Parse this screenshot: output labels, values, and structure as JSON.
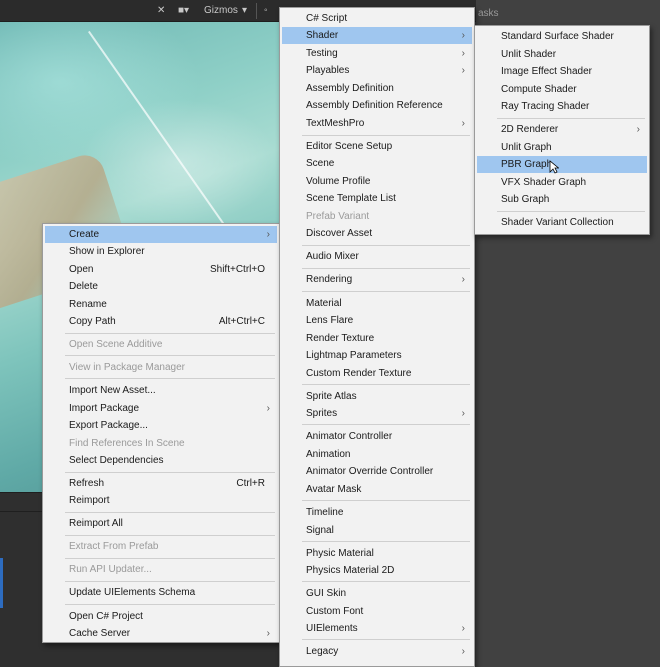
{
  "toolbar": {
    "gizmos_label": "Gizmos",
    "tasks_label": "asks"
  },
  "context_menu": {
    "items": [
      {
        "label": "Create",
        "arrow": "›"
      },
      {
        "label": "Show in Explorer"
      },
      {
        "label": "Open",
        "shortcut": "Shift+Ctrl+O"
      },
      {
        "label": "Delete"
      },
      {
        "label": "Rename"
      },
      {
        "label": "Copy Path",
        "shortcut": "Alt+Ctrl+C"
      },
      {
        "label": "Open Scene Additive"
      },
      {
        "label": "View in Package Manager"
      },
      {
        "label": "Import New Asset..."
      },
      {
        "label": "Import Package",
        "arrow": "›"
      },
      {
        "label": "Export Package..."
      },
      {
        "label": "Find References In Scene"
      },
      {
        "label": "Select Dependencies"
      },
      {
        "label": "Refresh",
        "shortcut": "Ctrl+R"
      },
      {
        "label": "Reimport"
      },
      {
        "label": "Reimport All"
      },
      {
        "label": "Extract From Prefab"
      },
      {
        "label": "Run API Updater..."
      },
      {
        "label": "Update UIElements Schema"
      },
      {
        "label": "Open C# Project"
      },
      {
        "label": "Cache Server",
        "arrow": "›"
      }
    ]
  },
  "create_menu": {
    "items": [
      {
        "label": "C# Script"
      },
      {
        "label": "Shader",
        "arrow": "›"
      },
      {
        "label": "Testing",
        "arrow": "›"
      },
      {
        "label": "Playables",
        "arrow": "›"
      },
      {
        "label": "Assembly Definition"
      },
      {
        "label": "Assembly Definition Reference"
      },
      {
        "label": "TextMeshPro",
        "arrow": "›"
      },
      {
        "label": "Editor Scene Setup"
      },
      {
        "label": "Scene"
      },
      {
        "label": "Volume Profile"
      },
      {
        "label": "Scene Template List"
      },
      {
        "label": "Prefab Variant"
      },
      {
        "label": "Discover Asset"
      },
      {
        "label": "Audio Mixer"
      },
      {
        "label": "Rendering",
        "arrow": "›"
      },
      {
        "label": "Material"
      },
      {
        "label": "Lens Flare"
      },
      {
        "label": "Render Texture"
      },
      {
        "label": "Lightmap Parameters"
      },
      {
        "label": "Custom Render Texture"
      },
      {
        "label": "Sprite Atlas"
      },
      {
        "label": "Sprites",
        "arrow": "›"
      },
      {
        "label": "Animator Controller"
      },
      {
        "label": "Animation"
      },
      {
        "label": "Animator Override Controller"
      },
      {
        "label": "Avatar Mask"
      },
      {
        "label": "Timeline"
      },
      {
        "label": "Signal"
      },
      {
        "label": "Physic Material"
      },
      {
        "label": "Physics Material 2D"
      },
      {
        "label": "GUI Skin"
      },
      {
        "label": "Custom Font"
      },
      {
        "label": "UIElements",
        "arrow": "›"
      },
      {
        "label": "Legacy",
        "arrow": "›"
      }
    ]
  },
  "shader_menu": {
    "items": [
      {
        "label": "Standard Surface Shader"
      },
      {
        "label": "Unlit Shader"
      },
      {
        "label": "Image Effect Shader"
      },
      {
        "label": "Compute Shader"
      },
      {
        "label": "Ray Tracing Shader"
      },
      {
        "label": "2D Renderer",
        "arrow": "›"
      },
      {
        "label": "Unlit Graph"
      },
      {
        "label": "PBR Graph"
      },
      {
        "label": "VFX Shader Graph"
      },
      {
        "label": "Sub Graph"
      },
      {
        "label": "Shader Variant Collection"
      }
    ]
  }
}
